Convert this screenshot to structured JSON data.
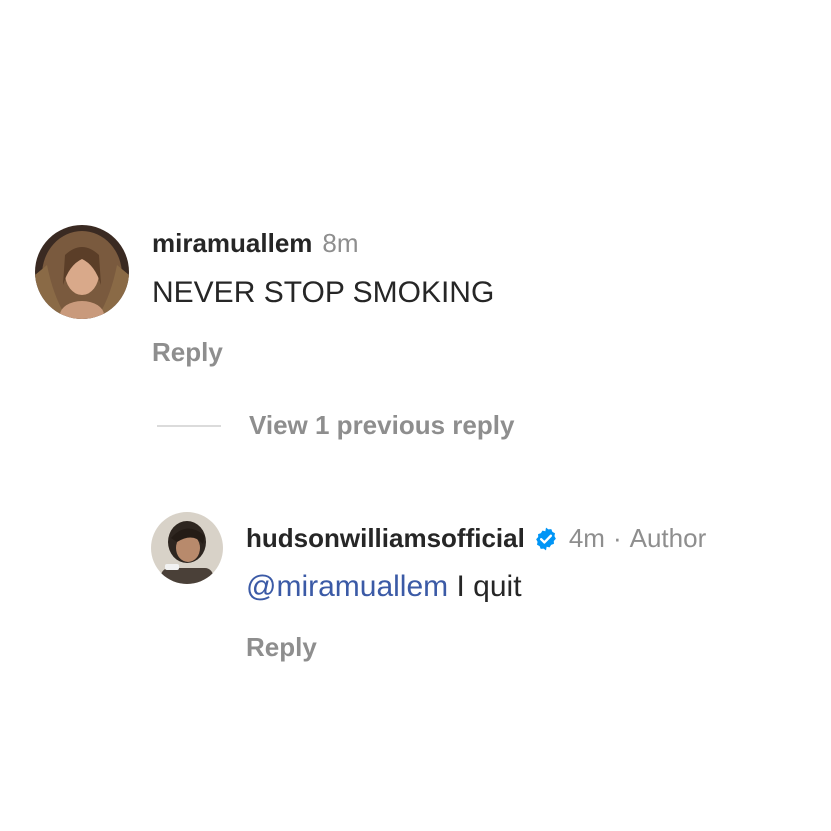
{
  "comments": [
    {
      "username": "miramuallem",
      "time": "8m",
      "text": "NEVER STOP SMOKING",
      "reply_label": "Reply",
      "avatar_icon": "profile-photo-curly-hair"
    }
  ],
  "thread": {
    "view_replies_label": "View 1 previous reply"
  },
  "reply": {
    "username": "hudsonwilliamsofficial",
    "verified_icon": "verified-badge-icon",
    "time": "4m",
    "separator": "·",
    "role": "Author",
    "mention": "@miramuallem",
    "text": " I quit",
    "reply_label": "Reply",
    "avatar_icon": "profile-photo-person"
  },
  "colors": {
    "text": "#262626",
    "meta": "#8e8e8e",
    "mention": "#3b5aa6",
    "verified": "#0095f6",
    "divider": "#dbdbdb"
  }
}
